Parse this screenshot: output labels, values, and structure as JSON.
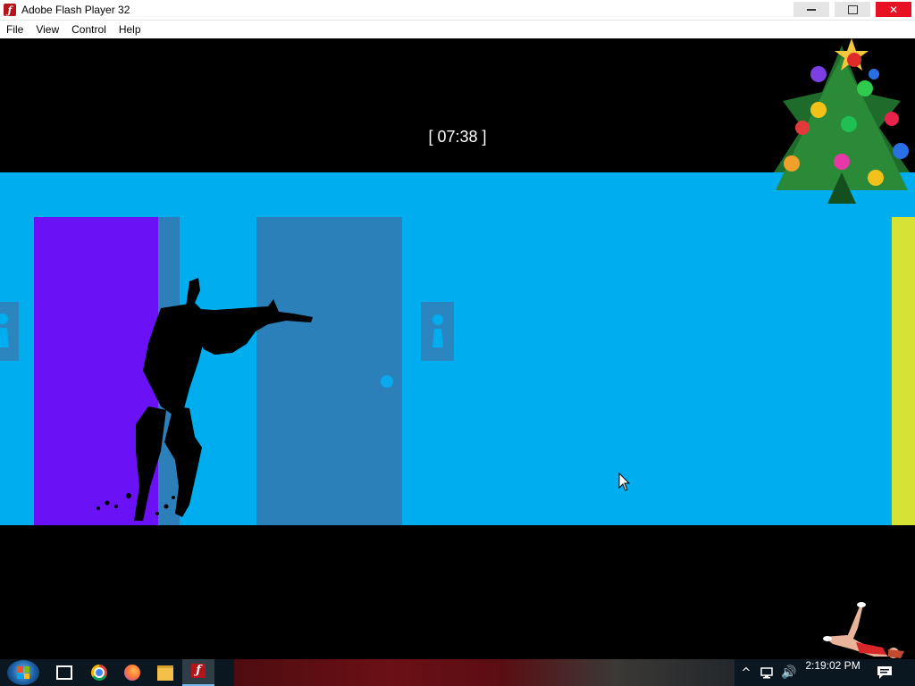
{
  "window": {
    "title": "Adobe Flash Player 32",
    "app_icon": "flash-player-icon",
    "controls": [
      "minimize-icon",
      "maximize-icon",
      "close-icon"
    ]
  },
  "menu": [
    {
      "label": "File"
    },
    {
      "label": "View"
    },
    {
      "label": "Control"
    },
    {
      "label": "Help"
    }
  ],
  "game": {
    "timer": "[ 07:38 ]",
    "colors": {
      "background": "#000000",
      "corridor": "#00aeef",
      "door_purple": "#6a12f5",
      "door_blue": "#2b80b9",
      "door_yellow": "#d6e236"
    },
    "scene_objects": [
      "soldier-silhouette",
      "purple-door",
      "blue-door",
      "yellow-door",
      "restroom-sign-left",
      "restroom-sign-mid"
    ]
  },
  "overlays": [
    "christmas-tree",
    "dancing-figure"
  ],
  "taskbar": {
    "start": "windows-start-icon",
    "pinned": [
      "task-view-icon",
      "chrome-icon",
      "firefox-icon",
      "file-explorer-icon",
      "flash-player-icon"
    ],
    "active": "flash-player-icon",
    "tray_icons": [
      "chevron-up-icon",
      "network-icon",
      "volume-icon"
    ],
    "clock": "2:19:02 PM",
    "notification_icon": "action-center-icon"
  }
}
